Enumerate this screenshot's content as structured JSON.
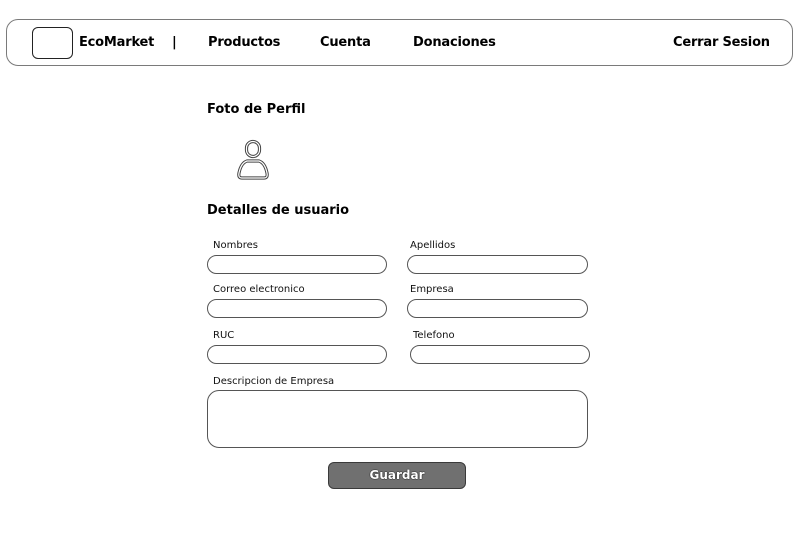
{
  "nav": {
    "brand": "EcoMarket",
    "separator": "|",
    "items": [
      "Productos",
      "Cuenta",
      "Donaciones"
    ],
    "logout": "Cerrar Sesion"
  },
  "profile": {
    "photo_title": "Foto de Perfil",
    "avatar_icon": "user-outline-icon"
  },
  "details": {
    "title": "Detalles de usuario",
    "fields": {
      "nombres": {
        "label": "Nombres",
        "value": ""
      },
      "apellidos": {
        "label": "Apellidos",
        "value": ""
      },
      "correo": {
        "label": "Correo electronico",
        "value": ""
      },
      "empresa": {
        "label": "Empresa",
        "value": ""
      },
      "ruc": {
        "label": "RUC",
        "value": ""
      },
      "telefono": {
        "label": "Telefono",
        "value": ""
      },
      "descripcion": {
        "label": "Descripcion de Empresa",
        "value": ""
      }
    }
  },
  "actions": {
    "save_label": "Guardar"
  }
}
